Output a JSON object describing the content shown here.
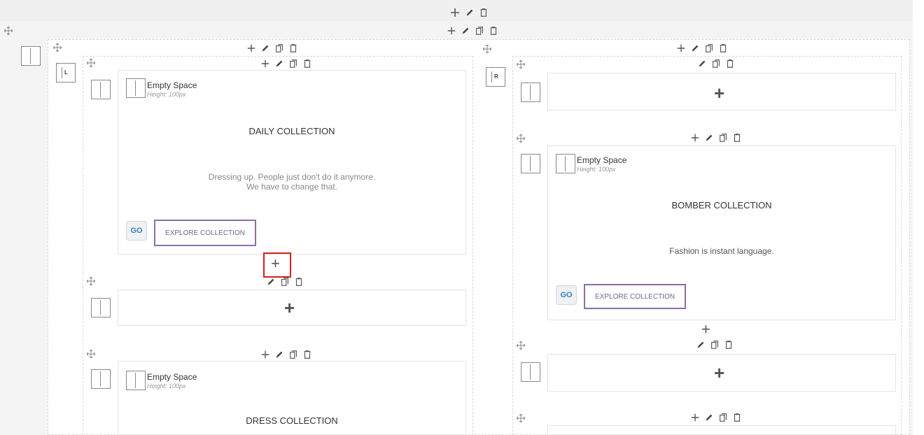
{
  "icons": {
    "plus": "+",
    "move": "move-icon",
    "edit": "pencil-icon",
    "copy": "copy-icon",
    "delete": "trash-icon"
  },
  "left_column": {
    "tag": "L",
    "block1": {
      "empty_space_title": "Empty Space",
      "empty_space_height": "Height: 100px",
      "heading": "DAILY COLLECTION",
      "paragraph_line1": "Dressing up. People just don't do it anymore.",
      "paragraph_line2": "We have to change that.",
      "go_label": "GO",
      "button_label": "EXPLORE COLLECTION"
    },
    "block3": {
      "empty_space_title": "Empty Space",
      "empty_space_height": "Height: 100px",
      "heading": "DRESS COLLECTION"
    }
  },
  "right_column": {
    "tag": "R",
    "block2": {
      "empty_space_title": "Empty Space",
      "empty_space_height": "Height: 100px",
      "heading": "BOMBER COLLECTION",
      "paragraph": "Fashion is instant language.",
      "go_label": "GO",
      "button_label": "EXPLORE COLLECTION"
    }
  },
  "colors": {
    "highlight": "#d61f1f",
    "button_border": "#8a6ea5",
    "go_text": "#3e7fb7"
  }
}
